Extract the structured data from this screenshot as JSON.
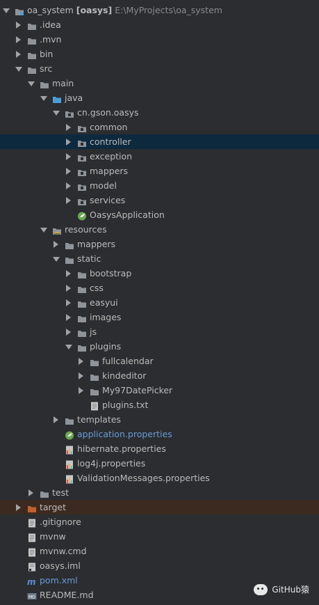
{
  "colors": {
    "background": "#2b2d30",
    "text": "#bbbbbb",
    "muted_text": "#8a8a8a",
    "selection": "#0d293e",
    "folder": "#8f949b",
    "folder_source": "#4a9fd8",
    "folder_excluded": "#c2612c",
    "maven_blue": "#6a9bd6"
  },
  "tree": [
    {
      "label": "oa_system",
      "extra": "[oasys]",
      "path": "E:\\MyProjects\\oa_system",
      "icon": "module-icon",
      "depth": 0,
      "expanded": true
    },
    {
      "label": ".idea",
      "icon": "folder-icon",
      "depth": 1,
      "expanded": false
    },
    {
      "label": ".mvn",
      "icon": "folder-icon",
      "depth": 1,
      "expanded": false
    },
    {
      "label": "bin",
      "icon": "folder-icon",
      "depth": 1,
      "expanded": false
    },
    {
      "label": "src",
      "icon": "folder-icon",
      "depth": 1,
      "expanded": true
    },
    {
      "label": "main",
      "icon": "folder-icon",
      "depth": 2,
      "expanded": true
    },
    {
      "label": "java",
      "icon": "source-folder-icon",
      "depth": 3,
      "expanded": true
    },
    {
      "label": "cn.gson.oasys",
      "icon": "package-icon",
      "depth": 4,
      "expanded": true
    },
    {
      "label": "common",
      "icon": "package-icon",
      "depth": 5,
      "expanded": false
    },
    {
      "label": "controller",
      "icon": "package-icon",
      "depth": 5,
      "expanded": false,
      "selected": true
    },
    {
      "label": "exception",
      "icon": "package-icon",
      "depth": 5,
      "expanded": false
    },
    {
      "label": "mappers",
      "icon": "package-icon",
      "depth": 5,
      "expanded": false
    },
    {
      "label": "model",
      "icon": "package-icon",
      "depth": 5,
      "expanded": false
    },
    {
      "label": "services",
      "icon": "package-icon",
      "depth": 5,
      "expanded": false
    },
    {
      "label": "OasysApplication",
      "icon": "spring-boot-class-icon",
      "depth": 5
    },
    {
      "label": "resources",
      "icon": "resources-folder-icon",
      "depth": 3,
      "expanded": true
    },
    {
      "label": "mappers",
      "icon": "folder-icon",
      "depth": 4,
      "expanded": false
    },
    {
      "label": "static",
      "icon": "folder-icon",
      "depth": 4,
      "expanded": true
    },
    {
      "label": "bootstrap",
      "icon": "folder-icon",
      "depth": 5,
      "expanded": false
    },
    {
      "label": "css",
      "icon": "folder-icon",
      "depth": 5,
      "expanded": false
    },
    {
      "label": "easyui",
      "icon": "folder-icon",
      "depth": 5,
      "expanded": false
    },
    {
      "label": "images",
      "icon": "folder-icon",
      "depth": 5,
      "expanded": false
    },
    {
      "label": "js",
      "icon": "folder-icon",
      "depth": 5,
      "expanded": false
    },
    {
      "label": "plugins",
      "icon": "folder-icon",
      "depth": 5,
      "expanded": true
    },
    {
      "label": "fullcalendar",
      "icon": "folder-icon",
      "depth": 6,
      "expanded": false
    },
    {
      "label": "kindeditor",
      "icon": "folder-icon",
      "depth": 6,
      "expanded": false
    },
    {
      "label": "My97DatePicker",
      "icon": "folder-icon",
      "depth": 6,
      "expanded": false
    },
    {
      "label": "plugins.txt",
      "icon": "text-file-icon",
      "depth": 6
    },
    {
      "label": "templates",
      "icon": "folder-icon",
      "depth": 4,
      "expanded": false
    },
    {
      "label": "application.properties",
      "icon": "spring-properties-icon",
      "depth": 4,
      "blue": true
    },
    {
      "label": "hibernate.properties",
      "icon": "properties-file-icon",
      "depth": 4
    },
    {
      "label": "log4j.properties",
      "icon": "properties-file-icon",
      "depth": 4
    },
    {
      "label": "ValidationMessages.properties",
      "icon": "properties-file-icon",
      "depth": 4
    },
    {
      "label": "test",
      "icon": "folder-icon",
      "depth": 2,
      "expanded": false
    },
    {
      "label": "target",
      "icon": "excluded-folder-icon",
      "depth": 1,
      "expanded": false,
      "target": true
    },
    {
      "label": ".gitignore",
      "icon": "text-file-icon",
      "depth": 1
    },
    {
      "label": "mvnw",
      "icon": "text-file-icon",
      "depth": 1
    },
    {
      "label": "mvnw.cmd",
      "icon": "text-file-icon",
      "depth": 1
    },
    {
      "label": "oasys.iml",
      "icon": "iml-file-icon",
      "depth": 1
    },
    {
      "label": "pom.xml",
      "icon": "maven-icon",
      "depth": 1,
      "blue": true
    },
    {
      "label": "README.md",
      "icon": "markdown-icon",
      "depth": 1
    }
  ],
  "watermark": {
    "text": "GitHub猿",
    "icon": "wechat-icon"
  }
}
